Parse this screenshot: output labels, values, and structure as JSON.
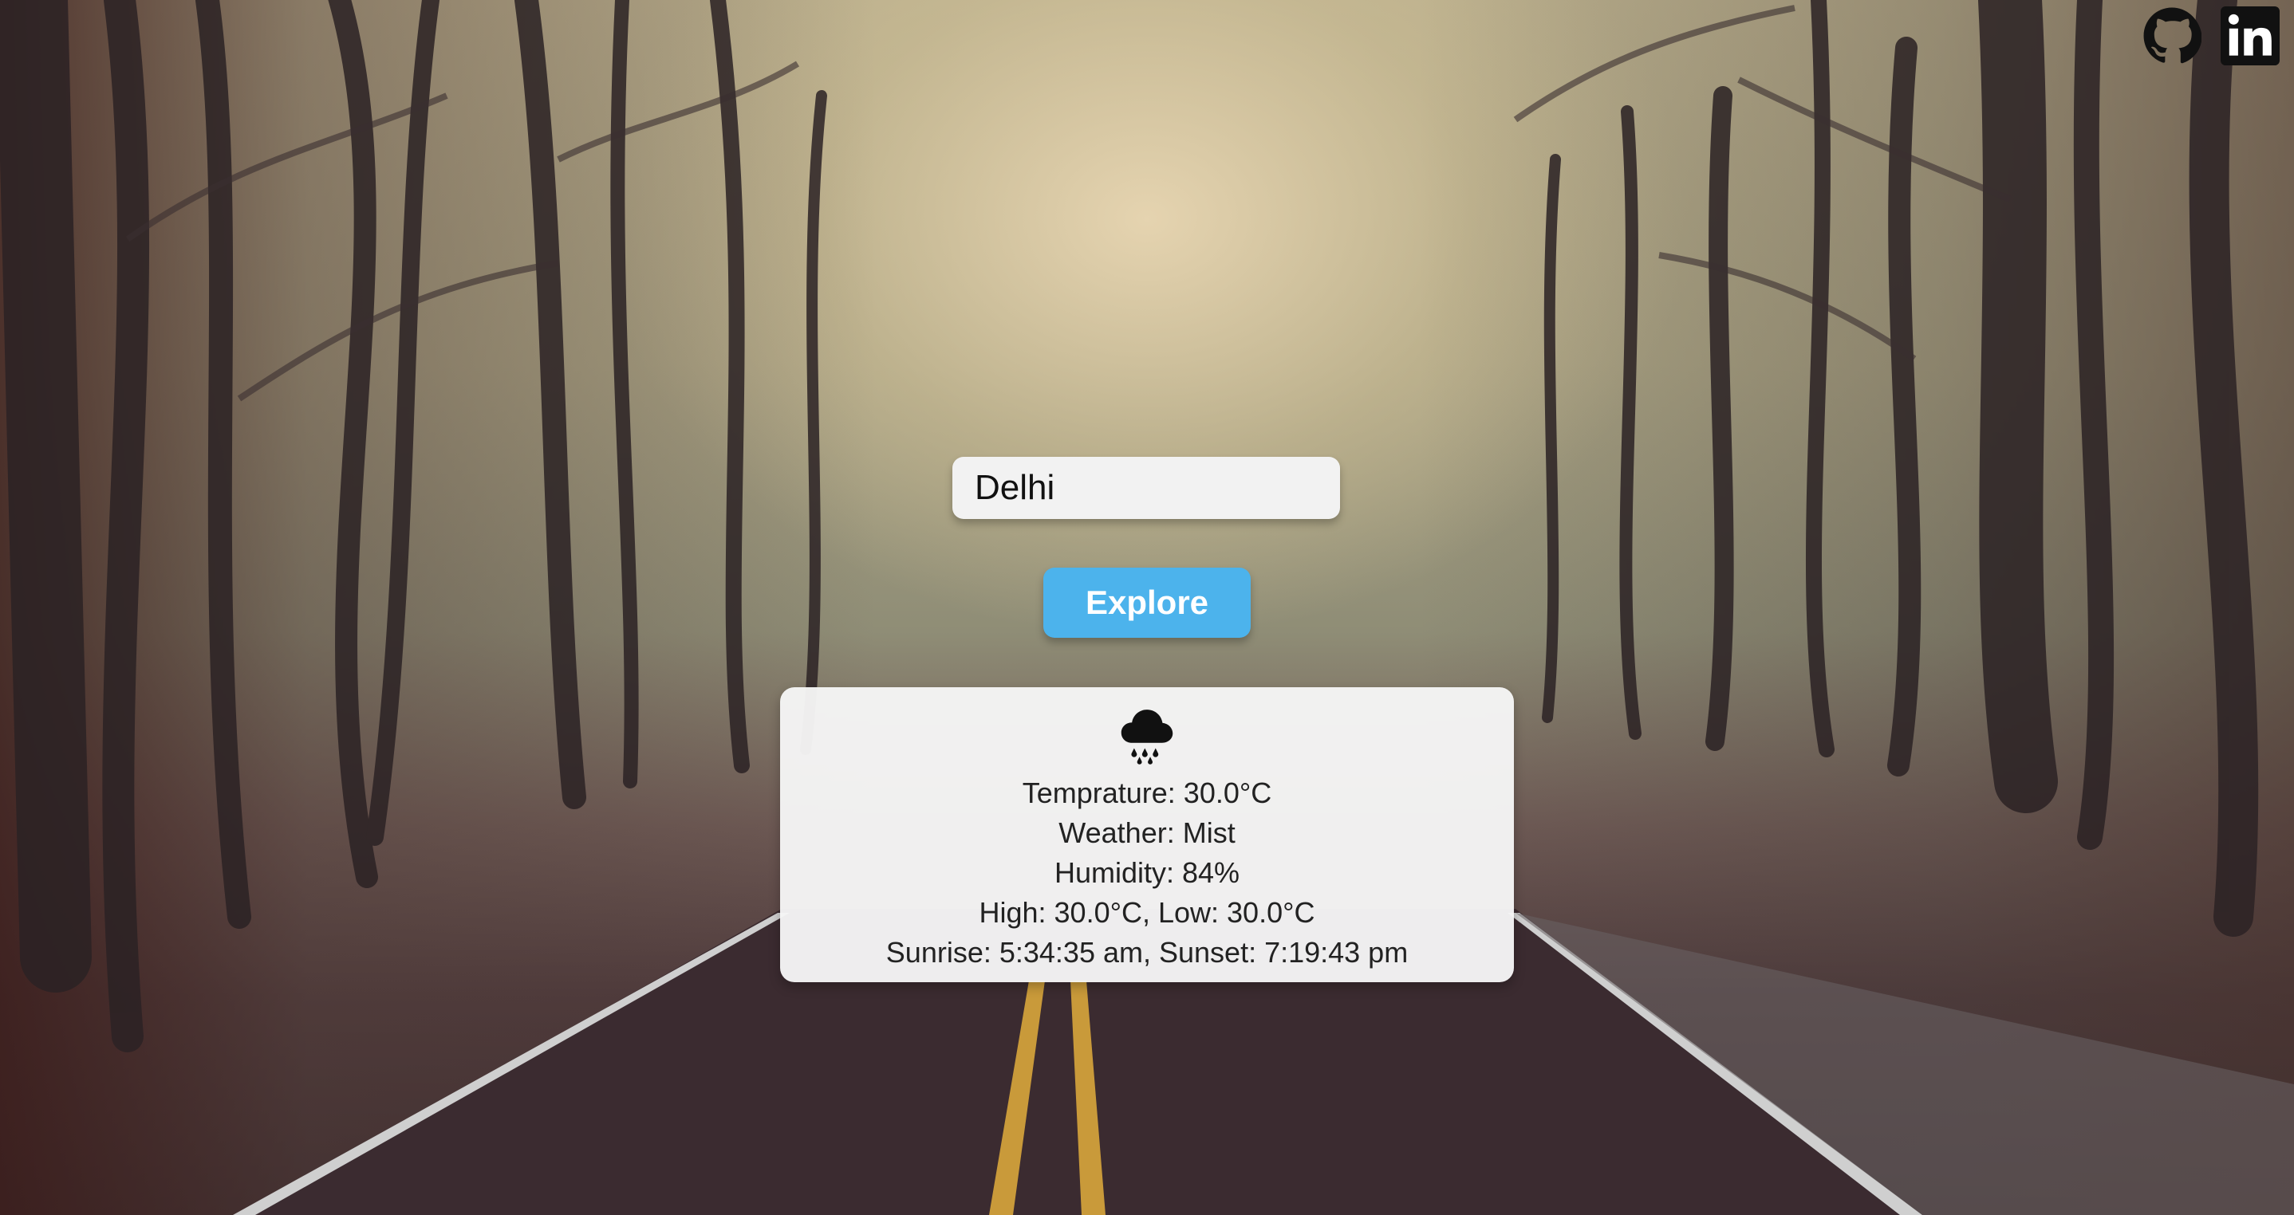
{
  "header": {
    "social_links": [
      {
        "name": "github",
        "icon": "github-icon"
      },
      {
        "name": "linkedin",
        "icon": "linkedin-icon"
      }
    ]
  },
  "search": {
    "value": "Delhi",
    "placeholder": ""
  },
  "explore_button": {
    "label": "Explore",
    "color": "#4cb3ec"
  },
  "weather": {
    "icon": "rain-cloud-icon",
    "temperature_line": "Temprature: 30.0°C",
    "weather_line": "Weather: Mist",
    "humidity_line": "Humidity: 84%",
    "high_low_line": "High: 30.0°C, Low: 30.0°C",
    "sun_line": "Sunrise: 5:34:35 am, Sunset: 7:19:43 pm"
  }
}
